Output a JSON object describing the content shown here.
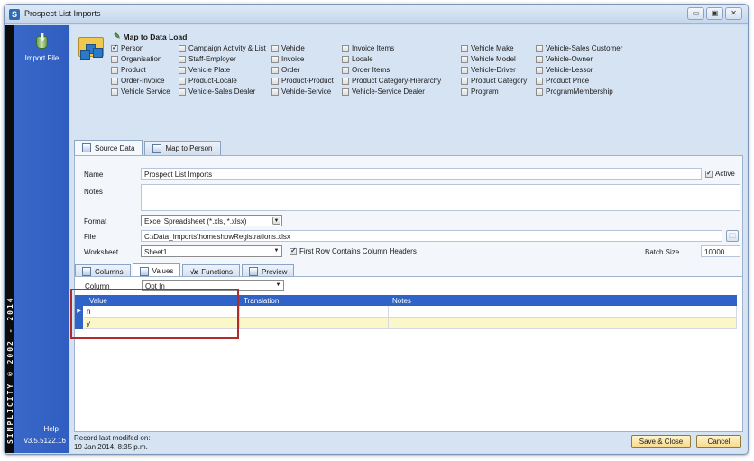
{
  "window": {
    "icon_letter": "S",
    "title": "Prospect List Imports",
    "controls": {
      "minimize": "▭",
      "maximize": "▣",
      "close": "✕"
    }
  },
  "sidebar": {
    "import_label": "Import File",
    "brand_text": "SIMPLICITY © 2002 - 2014",
    "help_label": "Help",
    "version": "v3.5.5122.16"
  },
  "map_to_data_load": {
    "title": "Map to Data Load",
    "columns": [
      [
        {
          "label": "Person",
          "checked": true
        },
        {
          "label": "Organisation",
          "checked": false
        },
        {
          "label": "Product",
          "checked": false
        },
        {
          "label": "Order-Invoice",
          "checked": false
        },
        {
          "label": "Vehicle Service",
          "checked": false
        }
      ],
      [
        {
          "label": "Campaign Activity & List",
          "checked": false
        },
        {
          "label": "Staff-Employer",
          "checked": false
        },
        {
          "label": "Vehicle Plate",
          "checked": false
        },
        {
          "label": "Product-Locale",
          "checked": false
        },
        {
          "label": "Vehicle-Sales Dealer",
          "checked": false
        }
      ],
      [
        {
          "label": "Vehicle",
          "checked": false
        },
        {
          "label": "Invoice",
          "checked": false
        },
        {
          "label": "Order",
          "checked": false
        },
        {
          "label": "Product-Product",
          "checked": false
        },
        {
          "label": "Vehicle-Service",
          "checked": false
        }
      ],
      [
        {
          "label": "Invoice Items",
          "checked": false
        },
        {
          "label": "Locale",
          "checked": false
        },
        {
          "label": "Order Items",
          "checked": false
        },
        {
          "label": "Product Category-Hierarchy",
          "checked": false
        },
        {
          "label": "Vehicle-Service Dealer",
          "checked": false
        }
      ],
      [
        {
          "label": "Vehicle Make",
          "checked": false
        },
        {
          "label": "Vehicle Model",
          "checked": false
        },
        {
          "label": "Vehicle-Driver",
          "checked": false
        },
        {
          "label": "Product Category",
          "checked": false
        },
        {
          "label": "Program",
          "checked": false
        }
      ],
      [
        {
          "label": "Vehicle-Sales Customer",
          "checked": false
        },
        {
          "label": "Vehicle-Owner",
          "checked": false
        },
        {
          "label": "Vehicle-Lessor",
          "checked": false
        },
        {
          "label": "Product Price",
          "checked": false
        },
        {
          "label": "ProgramMembership",
          "checked": false
        }
      ]
    ]
  },
  "tabs": {
    "source_data": "Source Data",
    "map_to_person": "Map to Person"
  },
  "form": {
    "name_label": "Name",
    "name_value": "Prospect List Imports",
    "active_label": "Active",
    "active_checked": true,
    "notes_label": "Notes",
    "notes_value": "",
    "format_label": "Format",
    "format_value": "Excel Spreadsheet (*.xls, *.xlsx)",
    "file_label": "File",
    "file_value": "C:\\Data_Imports\\homeshowRegistrations.xlsx",
    "worksheet_label": "Worksheet",
    "worksheet_value": "Sheet1",
    "first_row_label": "First Row Contains Column Headers",
    "first_row_checked": true,
    "batch_size_label": "Batch Size",
    "batch_size_value": "10000"
  },
  "subtabs": {
    "columns": "Columns",
    "values": "Values",
    "functions": "Functions",
    "preview": "Preview"
  },
  "values_panel": {
    "column_label": "Column",
    "column_value": "Opt In",
    "grid_headers": [
      "Value",
      "Translation",
      "Notes"
    ],
    "rows": [
      {
        "value": "n",
        "translation": "",
        "notes": ""
      },
      {
        "value": "y",
        "translation": "",
        "notes": ""
      }
    ]
  },
  "footer": {
    "record_label": "Record last modifed on:",
    "record_date": "19 Jan 2014, 8:35 p.m.",
    "save_close": "Save & Close",
    "cancel": "Cancel"
  }
}
